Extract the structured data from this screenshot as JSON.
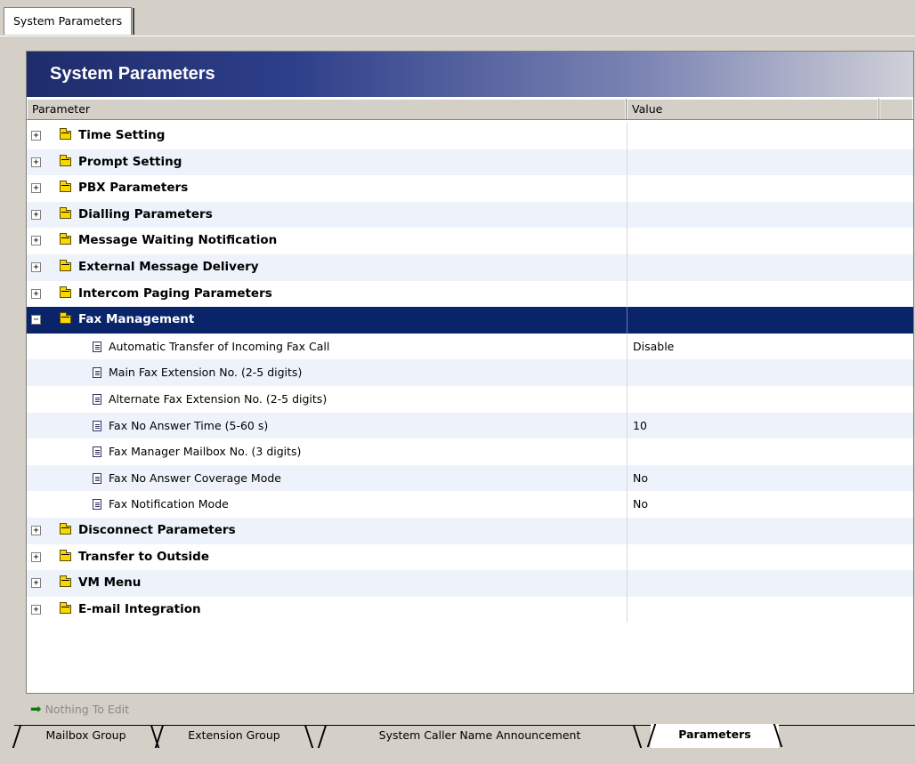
{
  "window": {
    "top_tab": "System Parameters"
  },
  "panel": {
    "title": "System Parameters",
    "columns": {
      "parameter": "Parameter",
      "value": "Value"
    }
  },
  "rows": [
    {
      "type": "group",
      "label": "Time Setting",
      "expanded": false
    },
    {
      "type": "group",
      "label": "Prompt Setting",
      "expanded": false
    },
    {
      "type": "group",
      "label": "PBX Parameters",
      "expanded": false
    },
    {
      "type": "group",
      "label": "Dialling Parameters",
      "expanded": false
    },
    {
      "type": "group",
      "label": "Message Waiting Notification",
      "expanded": false
    },
    {
      "type": "group",
      "label": "External Message Delivery",
      "expanded": false
    },
    {
      "type": "group",
      "label": "Intercom Paging Parameters",
      "expanded": false
    },
    {
      "type": "group",
      "label": "Fax Management",
      "expanded": true,
      "selected": true
    },
    {
      "type": "param",
      "label": "Automatic Transfer of Incoming Fax Call",
      "value": "Disable"
    },
    {
      "type": "param",
      "label": "Main Fax Extension No. (2-5 digits)",
      "value": ""
    },
    {
      "type": "param",
      "label": "Alternate Fax Extension No. (2-5 digits)",
      "value": ""
    },
    {
      "type": "param",
      "label": "Fax No Answer Time (5-60 s)",
      "value": "10"
    },
    {
      "type": "param",
      "label": "Fax Manager Mailbox No. (3 digits)",
      "value": ""
    },
    {
      "type": "param",
      "label": "Fax No Answer Coverage Mode",
      "value": "No"
    },
    {
      "type": "param",
      "label": "Fax Notification Mode",
      "value": "No"
    },
    {
      "type": "group",
      "label": "Disconnect Parameters",
      "expanded": false
    },
    {
      "type": "group",
      "label": "Transfer to Outside",
      "expanded": false
    },
    {
      "type": "group",
      "label": "VM Menu",
      "expanded": false
    },
    {
      "type": "group",
      "label": "E-mail Integration",
      "expanded": false
    }
  ],
  "status": {
    "text": "Nothing To Edit"
  },
  "bottom_tabs": [
    {
      "label": "Mailbox Group",
      "active": false
    },
    {
      "label": "Extension Group",
      "active": false
    },
    {
      "label": "System Caller Name Announcement",
      "active": false
    },
    {
      "label": "Parameters",
      "active": true
    }
  ],
  "colors": {
    "selection": "#0a246a",
    "alt_row": "#eef3fb",
    "title_dark": "#1f2c6b"
  },
  "icons": {
    "group": "folder-icon",
    "param": "document-icon",
    "collapsed": "plus-expander-icon",
    "expanded": "minus-expander-icon",
    "status": "arrow-right-icon"
  }
}
